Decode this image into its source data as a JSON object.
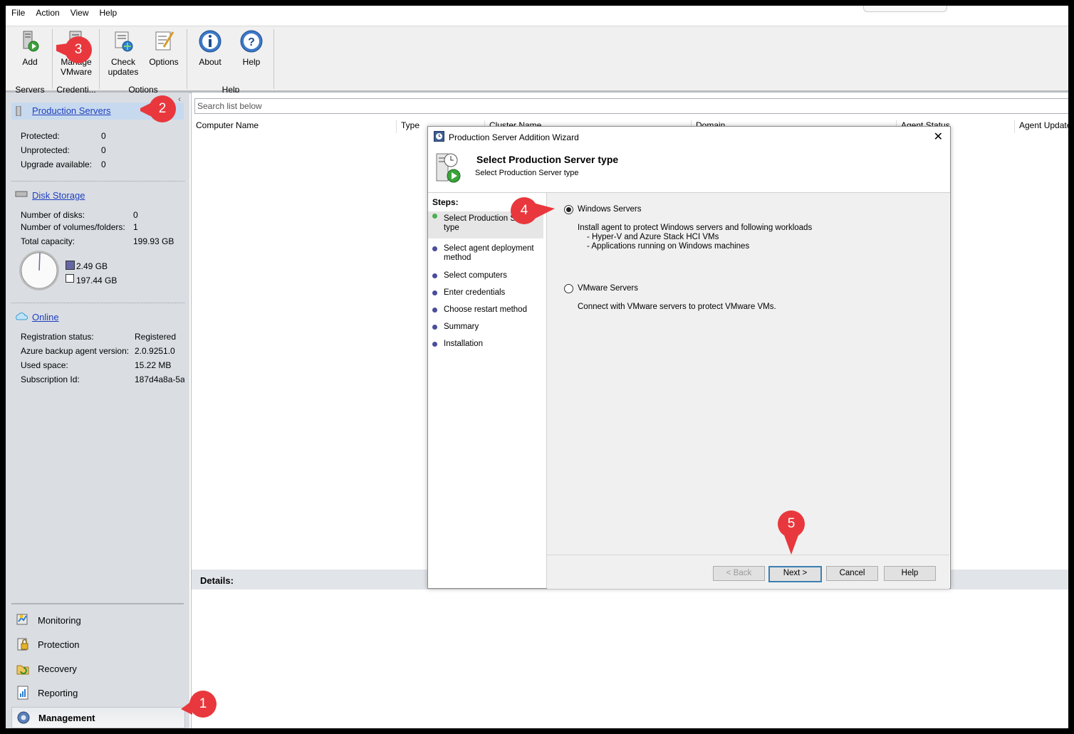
{
  "menu": [
    "File",
    "Action",
    "View",
    "Help"
  ],
  "ribbon": {
    "buttons": {
      "add": "Add",
      "manage_line1": "Manage",
      "manage_line2": "VMware",
      "check_line1": "Check",
      "check_line2": "updates",
      "options": "Options",
      "about": "About",
      "help": "Help"
    },
    "groups": {
      "servers": "Servers",
      "credentials": "Credenti...",
      "options": "Options",
      "help": "Help"
    }
  },
  "nav": {
    "production": {
      "title": "Production Servers",
      "protected_label": "Protected:",
      "protected_value": "0",
      "unprotected_label": "Unprotected:",
      "unprotected_value": "0",
      "upgrade_label": "Upgrade available:",
      "upgrade_value": "0"
    },
    "disk": {
      "title": "Disk Storage",
      "disks_label": "Number of disks:",
      "disks_value": "0",
      "volumes_label": "Number of volumes/folders:",
      "volumes_value": "1",
      "capacity_label": "Total capacity:",
      "capacity_value": "199.93 GB",
      "used_legend": "2.49 GB",
      "free_legend": "197.44 GB"
    },
    "online": {
      "title": "Online",
      "reg_label": "Registration status:",
      "reg_value": "Registered",
      "agent_label": "Azure backup agent version:",
      "agent_value": "2.0.9251.0",
      "used_label": "Used space:",
      "used_value": "15.22 MB",
      "sub_label": "Subscription Id:",
      "sub_value": "187d4a8a-5a"
    },
    "workspaces": [
      "Monitoring",
      "Protection",
      "Recovery",
      "Reporting",
      "Management"
    ]
  },
  "main": {
    "search_placeholder": "Search list below",
    "columns": [
      "Computer Name",
      "Type",
      "Cluster Name",
      "Domain",
      "Agent Status",
      "Agent Update"
    ],
    "details_label": "Details:"
  },
  "wizard": {
    "title": "Production Server Addition Wizard",
    "heading": "Select Production Server type",
    "subheading": "Select Production Server type",
    "steps_label": "Steps:",
    "steps": [
      {
        "line1": "Select Production Se",
        "line2": "type"
      },
      {
        "line1": "Select agent deployment",
        "line2": "method"
      },
      {
        "line1": "Select computers",
        "line2": ""
      },
      {
        "line1": "Enter credentials",
        "line2": ""
      },
      {
        "line1": "Choose restart method",
        "line2": ""
      },
      {
        "line1": "Summary",
        "line2": ""
      },
      {
        "line1": "Installation",
        "line2": ""
      }
    ],
    "windows_option": "Windows Servers",
    "windows_desc1": "Install agent to protect Windows servers and following workloads",
    "windows_desc2": "- Hyper-V and Azure Stack HCI VMs",
    "windows_desc3": "- Applications running on Windows machines",
    "vmware_option": "VMware Servers",
    "vmware_desc": "Connect with VMware servers to protect VMware VMs.",
    "buttons": {
      "back": "< Back",
      "next": "Next >",
      "cancel": "Cancel",
      "help": "Help"
    }
  },
  "callouts": [
    "1",
    "2",
    "3",
    "4",
    "5"
  ],
  "colors": {
    "callout": "#e8383d",
    "link": "#1f3fbf",
    "nav_bg": "#dadee3",
    "selected_nav": "#c7d9ee"
  }
}
